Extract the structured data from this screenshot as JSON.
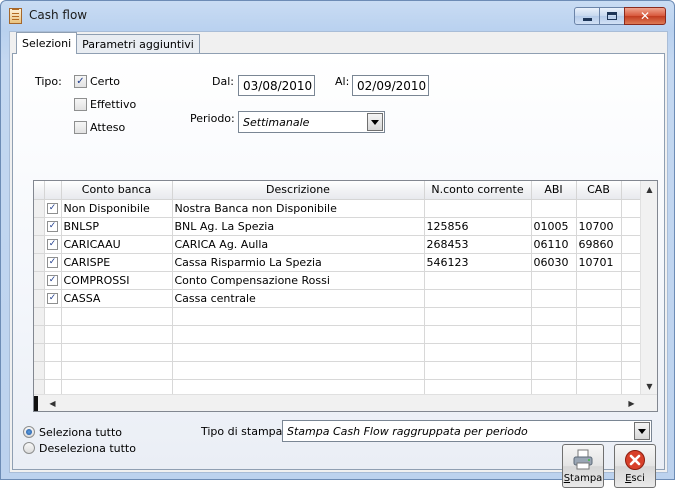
{
  "window": {
    "title": "Cash flow",
    "controls": {
      "minimize": "minimize-icon",
      "maximize": "maximize-icon",
      "close": "close-icon"
    }
  },
  "tabs": [
    {
      "label": "Selezioni",
      "active": true
    },
    {
      "label": "Parametri aggiuntivi",
      "active": false
    }
  ],
  "filters": {
    "tipo_label": "Tipo:",
    "tipo_options": [
      {
        "label": "Certo",
        "checked": true
      },
      {
        "label": "Effettivo",
        "checked": false
      },
      {
        "label": "Atteso",
        "checked": false
      }
    ],
    "dal_label": "Dal:",
    "dal_value": "03/08/2010",
    "al_label": "Al:",
    "al_value": "02/09/2010",
    "periodo_label": "Periodo:",
    "periodo_value": "Settimanale"
  },
  "grid": {
    "columns": [
      "Conto banca",
      "Descrizione",
      "N.conto corrente",
      "ABI",
      "CAB"
    ],
    "rows": [
      {
        "checked": true,
        "conto": "Non Disponibile",
        "descrizione": "Nostra Banca non Disponibile",
        "nconto": "",
        "abi": "",
        "cab": ""
      },
      {
        "checked": true,
        "conto": "BNLSP",
        "descrizione": "BNL Ag. La Spezia",
        "nconto": "125856",
        "abi": "01005",
        "cab": "10700"
      },
      {
        "checked": true,
        "conto": "CARICAAU",
        "descrizione": "CARICA Ag. Aulla",
        "nconto": "268453",
        "abi": "06110",
        "cab": "69860"
      },
      {
        "checked": true,
        "conto": "CARISPE",
        "descrizione": "Cassa Risparmio La Spezia",
        "nconto": "546123",
        "abi": "06030",
        "cab": "10701"
      },
      {
        "checked": true,
        "conto": "COMPROSSI",
        "descrizione": "Conto Compensazione Rossi",
        "nconto": "",
        "abi": "",
        "cab": ""
      },
      {
        "checked": true,
        "conto": "CASSA",
        "descrizione": "Cassa centrale",
        "nconto": "",
        "abi": "",
        "cab": ""
      }
    ]
  },
  "selection": {
    "seleziona_tutto": "Seleziona tutto",
    "deseleziona_tutto": "Deseleziona tutto",
    "selected": "seleziona_tutto"
  },
  "stampa": {
    "tipo_label": "Tipo di stampa:",
    "tipo_value": "Stampa Cash Flow raggruppata per periodo"
  },
  "buttons": {
    "stampa_label": "Stampa",
    "esci_label": "Esci"
  },
  "colors": {
    "title_bg": "#c4d8f1",
    "close_button": "#c23b20",
    "check_mark": "#1f3c8c"
  }
}
